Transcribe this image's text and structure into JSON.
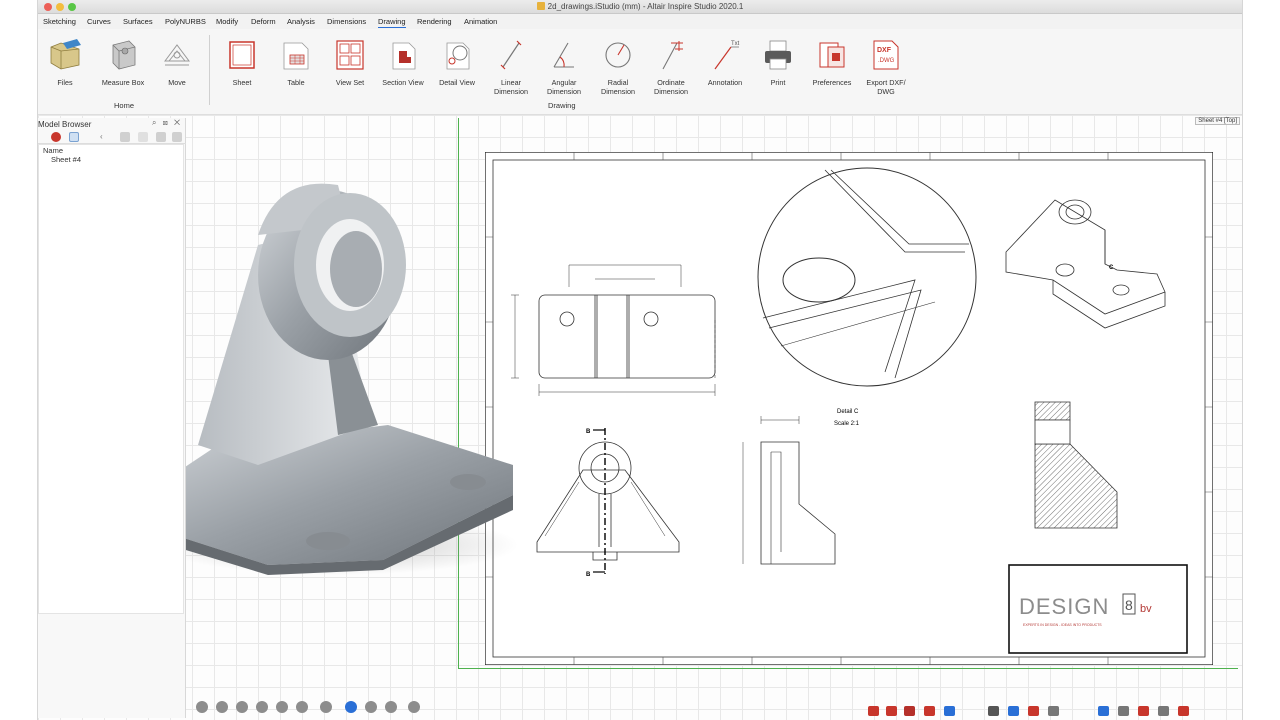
{
  "window": {
    "title": "2d_drawings.iStudio (mm) - Altair Inspire Studio 2020.1"
  },
  "menubar": {
    "items": [
      "Sketching",
      "Curves",
      "Surfaces",
      "PolyNURBS",
      "Modify",
      "Deform",
      "Analysis",
      "Dimensions",
      "Drawing",
      "Rendering",
      "Animation"
    ],
    "active": "Drawing"
  },
  "ribbon": {
    "group_label": "Home",
    "tools": {
      "files": "Files",
      "measure_box": "Measure Box",
      "move": "Move",
      "sheet": "Sheet",
      "table": "Table",
      "view_set": "View Set",
      "section_view": "Section View",
      "detail_view": "Detail View",
      "linear_dimension": "Linear\nDimension",
      "angular_dimension": "Angular\nDimension",
      "radial_dimension": "Radial\nDimension",
      "ordinate_dimension": "Ordinate\nDimension",
      "annotation": "Annotation",
      "print": "Print",
      "preferences": "Preferences",
      "export_dxf": "Export DXF/\nDWG"
    },
    "drawing_group_label": "Drawing"
  },
  "model_browser": {
    "title": "Model Browser",
    "column_header": "Name",
    "items": [
      "Sheet #4"
    ]
  },
  "viewport": {
    "sheet_tab": "Sheet #4 [Top]"
  },
  "drawing": {
    "detail_label": "Detail C",
    "scale_label": "Scale  2:1",
    "section_marker": "B",
    "detail_marker": "C",
    "logo_main": "DESIGN",
    "logo_8": "8",
    "logo_suffix": "bv",
    "logo_tagline": "EXPERTS IN DESIGN - IDEAS INTO PRODUCTS",
    "border_top_numbers": [
      "1",
      "2",
      "3",
      "4",
      "5",
      "6",
      "7",
      "8"
    ],
    "border_side_letters": [
      "F",
      "E",
      "D",
      "C",
      "B",
      "A"
    ]
  },
  "colors": {
    "accent": "#2a6fd6",
    "ribbon_red": "#c8362c",
    "grid": "#e8e8e8",
    "frame_green": "#4fb24f"
  }
}
